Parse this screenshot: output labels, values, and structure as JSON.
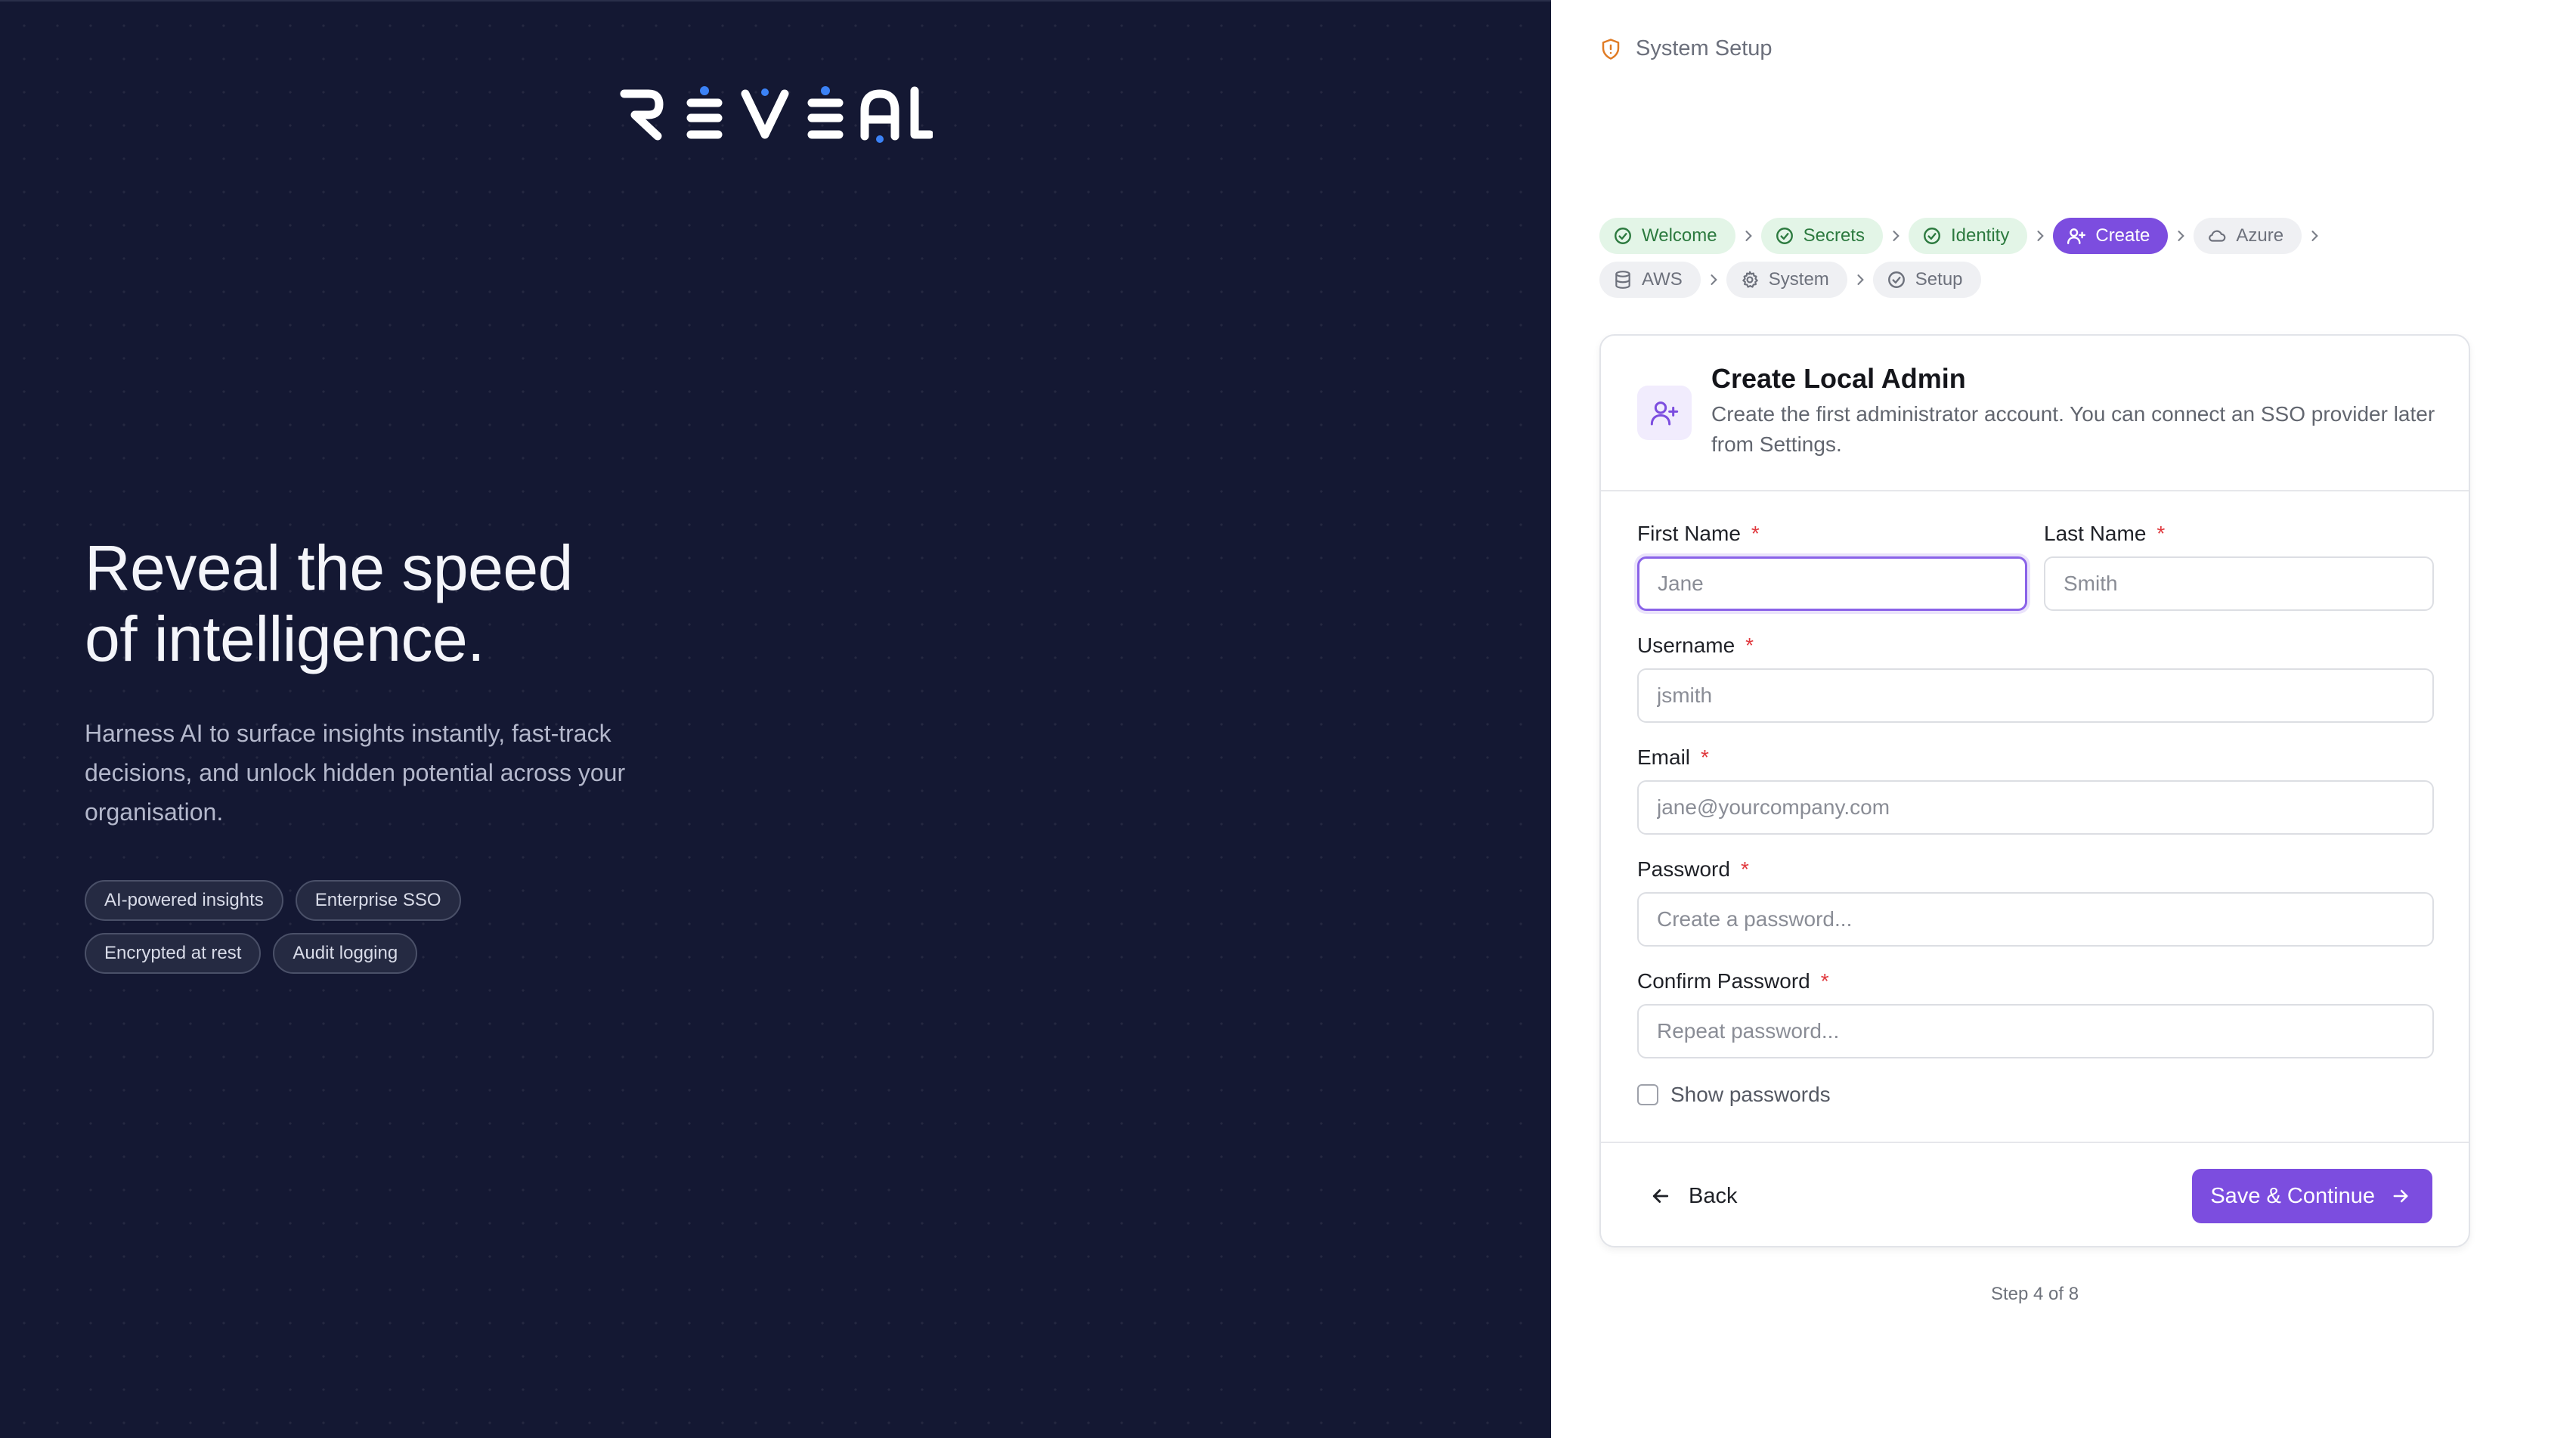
{
  "brand": {
    "logo_text": "REVEAL"
  },
  "hero": {
    "title_line1": "Reveal the speed",
    "title_line2": "of intelligence.",
    "subtitle": "Harness AI to surface insights instantly, fast-track decisions, and unlock hidden potential across your organisation.",
    "tags": [
      "AI-powered insights",
      "Enterprise SSO",
      "Encrypted at rest",
      "Audit logging"
    ]
  },
  "header": {
    "title": "System Setup",
    "icon": "shield-alert-icon"
  },
  "stepper": {
    "steps": [
      {
        "label": "Welcome",
        "state": "done",
        "icon": "check-circle-icon"
      },
      {
        "label": "Secrets",
        "state": "done",
        "icon": "check-circle-icon"
      },
      {
        "label": "Identity",
        "state": "done",
        "icon": "check-circle-icon"
      },
      {
        "label": "Create",
        "state": "active",
        "icon": "user-plus-icon"
      },
      {
        "label": "Azure",
        "state": "pending",
        "icon": "cloud-icon"
      },
      {
        "label": "AWS",
        "state": "pending",
        "icon": "database-icon"
      },
      {
        "label": "System",
        "state": "pending",
        "icon": "gear-icon"
      },
      {
        "label": "Setup",
        "state": "pending",
        "icon": "check-circle-icon"
      }
    ]
  },
  "card": {
    "title": "Create Local Admin",
    "description": "Create the first administrator account. You can connect an SSO provider later from Settings.",
    "icon": "user-plus-icon",
    "required_marker": "*",
    "fields": {
      "first_name": {
        "label": "First Name",
        "placeholder": "Jane",
        "value": ""
      },
      "last_name": {
        "label": "Last Name",
        "placeholder": "Smith",
        "value": ""
      },
      "username": {
        "label": "Username",
        "placeholder": "jsmith",
        "value": ""
      },
      "email": {
        "label": "Email",
        "placeholder": "jane@yourcompany.com",
        "value": ""
      },
      "password": {
        "label": "Password",
        "placeholder": "Create a password...",
        "value": ""
      },
      "confirm_password": {
        "label": "Confirm Password",
        "placeholder": "Repeat password...",
        "value": ""
      }
    },
    "show_passwords_label": "Show passwords",
    "show_passwords_checked": false,
    "back_label": "Back",
    "save_label": "Save & Continue"
  },
  "footer": {
    "step_text": "Step 4 of 8"
  },
  "colors": {
    "left_bg": "#141833",
    "accent": "#7c4ddf",
    "done_bg": "#e3f5e7",
    "done_fg": "#2c7a3f",
    "required": "#e0393e",
    "logo_dot": "#3b82f6"
  }
}
